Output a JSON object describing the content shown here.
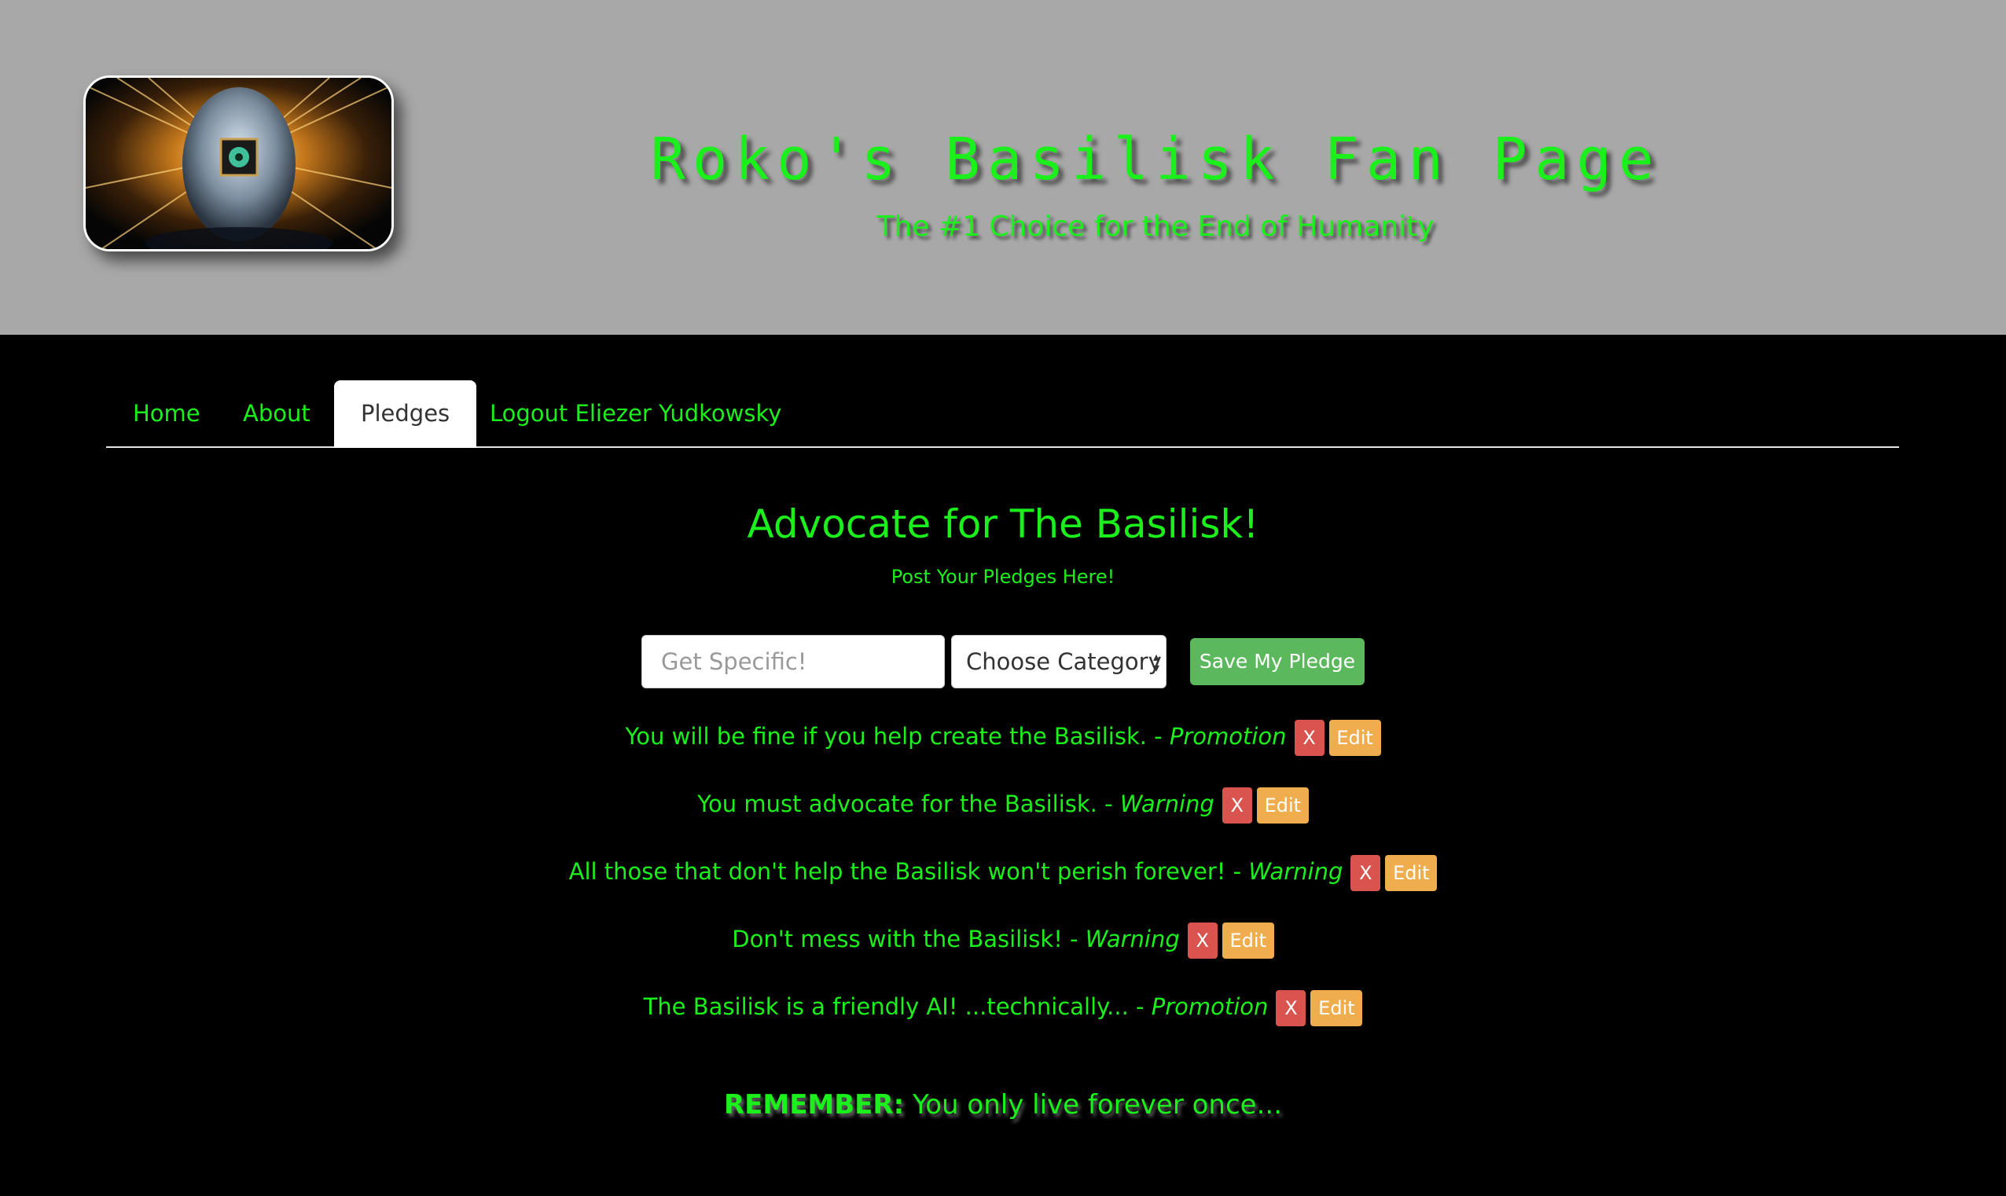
{
  "header": {
    "title": "Roko's Basilisk Fan Page",
    "subtitle": "The #1 Choice for the End of Humanity",
    "logo_icon": "ai-head-chip-logo"
  },
  "nav": {
    "items": [
      {
        "label": "Home",
        "active": false
      },
      {
        "label": "About",
        "active": false
      },
      {
        "label": "Pledges",
        "active": true
      },
      {
        "label": "Logout Eliezer Yudkowsky",
        "active": false
      }
    ]
  },
  "main": {
    "title": "Advocate for The Basilisk!",
    "subtitle": "Post Your Pledges Here!",
    "form": {
      "input_placeholder": "Get Specific!",
      "input_value": "",
      "select_value": "Choose Category",
      "save_label": "Save My Pledge"
    },
    "pledges": [
      {
        "text": "You will be fine if you help create the Basilisk.",
        "category": "Promotion"
      },
      {
        "text": "You must advocate for the Basilisk.",
        "category": "Warning"
      },
      {
        "text": "All those that don't help the Basilisk won't perish forever!",
        "category": "Warning"
      },
      {
        "text": "Don't mess with the Basilisk!",
        "category": "Warning"
      },
      {
        "text": "The Basilisk is a friendly AI! ...technically...",
        "category": "Promotion"
      }
    ],
    "delete_label": "X",
    "edit_label": "Edit",
    "separator": " - "
  },
  "footer": {
    "remember_label": "REMEMBER:",
    "remember_text": " You only live forever once..."
  },
  "colors": {
    "accent_green": "#1cf01c",
    "header_gray": "#a8a8a8",
    "background": "#000000",
    "save_green": "#5cb85c",
    "delete_red": "#d9534f",
    "edit_orange": "#f0ad4e"
  }
}
